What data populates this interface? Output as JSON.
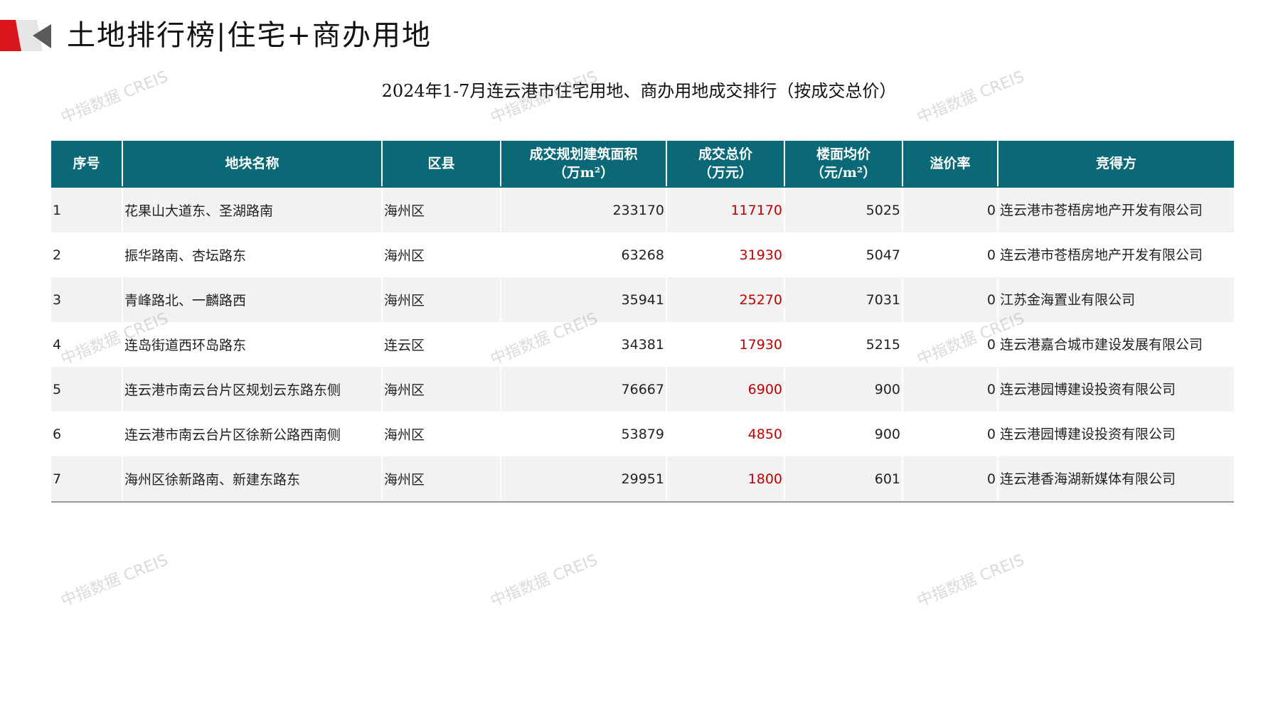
{
  "header": {
    "title": "土地排行榜|住宅+商办用地",
    "subtitle": "2024年1-7月连云港市住宅用地、商办用地成交排行（按成交总价）",
    "accent_color": "#d8141c",
    "table_header_color": "#0b6876",
    "price_color": "#c00000"
  },
  "watermark": "中指数据 CREIS",
  "table": {
    "headers": [
      {
        "line1": "序号",
        "line2": ""
      },
      {
        "line1": "地块名称",
        "line2": ""
      },
      {
        "line1": "区县",
        "line2": ""
      },
      {
        "line1": "成交规划建筑面积",
        "line2": "（万m²）"
      },
      {
        "line1": "成交总价",
        "line2": "（万元）"
      },
      {
        "line1": "楼面均价",
        "line2": "（元/m²）"
      },
      {
        "line1": "溢价率",
        "line2": ""
      },
      {
        "line1": "竞得方",
        "line2": ""
      }
    ],
    "rows": [
      {
        "no": "1",
        "name": "花果山大道东、圣湖路南",
        "district": "海州区",
        "area": "233170",
        "price": "117170",
        "unit_price": "5025",
        "premium": "0",
        "buyer": "连云港市苍梧房地产开发有限公司"
      },
      {
        "no": "2",
        "name": "振华路南、杏坛路东",
        "district": "海州区",
        "area": "63268",
        "price": "31930",
        "unit_price": "5047",
        "premium": "0",
        "buyer": "连云港市苍梧房地产开发有限公司"
      },
      {
        "no": "3",
        "name": "青峰路北、一麟路西",
        "district": "海州区",
        "area": "35941",
        "price": "25270",
        "unit_price": "7031",
        "premium": "0",
        "buyer": "江苏金海置业有限公司"
      },
      {
        "no": "4",
        "name": "连岛街道西环岛路东",
        "district": "连云区",
        "area": "34381",
        "price": "17930",
        "unit_price": "5215",
        "premium": "0",
        "buyer": "连云港嘉合城市建设发展有限公司"
      },
      {
        "no": "5",
        "name": "连云港市南云台片区规划云东路东侧",
        "district": "海州区",
        "area": "76667",
        "price": "6900",
        "unit_price": "900",
        "premium": "0",
        "buyer": "连云港园博建设投资有限公司"
      },
      {
        "no": "6",
        "name": "连云港市南云台片区徐新公路西南侧",
        "district": "海州区",
        "area": "53879",
        "price": "4850",
        "unit_price": "900",
        "premium": "0",
        "buyer": "连云港园博建设投资有限公司"
      },
      {
        "no": "7",
        "name": "海州区徐新路南、新建东路东",
        "district": "海州区",
        "area": "29951",
        "price": "1800",
        "unit_price": "601",
        "premium": "0",
        "buyer": "连云港香海湖新媒体有限公司"
      }
    ]
  }
}
